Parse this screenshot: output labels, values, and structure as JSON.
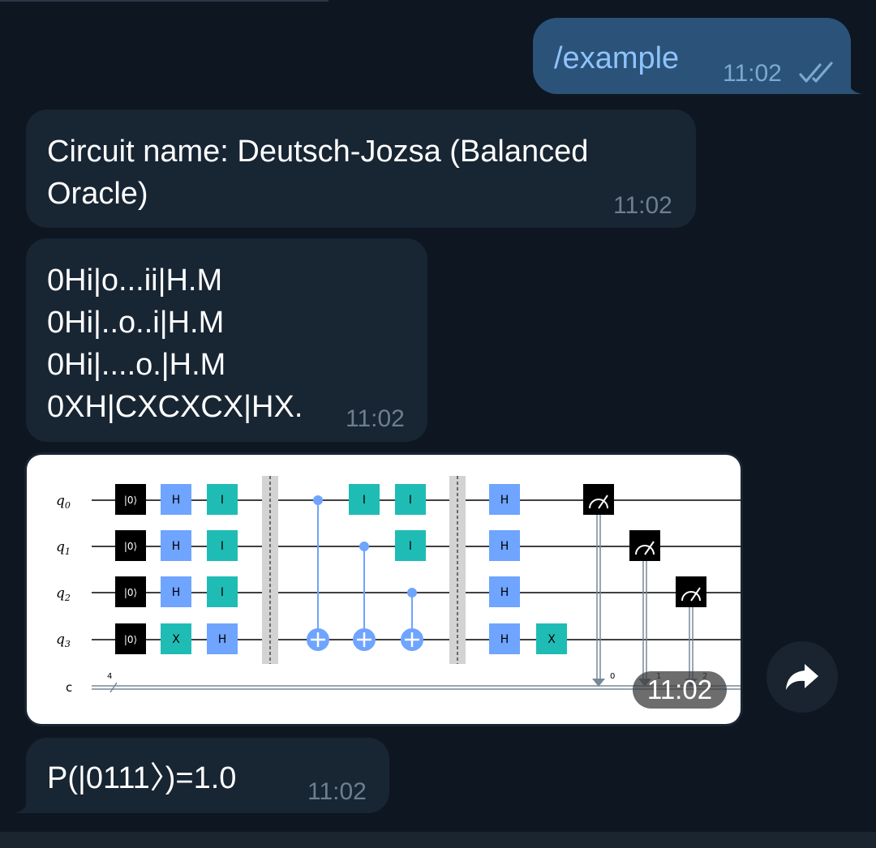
{
  "messages": [
    {
      "text": "/example",
      "time": "11:02",
      "status": "read"
    },
    {
      "line1": "Circuit name: Deutsch-Jozsa (Balanced",
      "line2": "Oracle)",
      "time": "11:02"
    },
    {
      "lines": [
        "0Hi|o...ii|H.M",
        "0Hi|..o..i|H.M",
        "0Hi|....o.|H.M",
        "0XH|CXCXCX|HX."
      ],
      "time": "11:02"
    },
    {
      "time": "11:02"
    },
    {
      "text": "P(|0111〉)=1.0",
      "time": "11:02"
    }
  ],
  "circuit": {
    "qubits": [
      "q",
      "q",
      "q",
      "q"
    ],
    "qubit_indices": [
      "0",
      "1",
      "2",
      "3"
    ],
    "classical": "c",
    "classical_width": "4",
    "init": "|0⟩",
    "gates": {
      "h": "H",
      "i": "I",
      "x": "X"
    },
    "measure_indices": [
      "0",
      "1",
      "2"
    ],
    "colors": {
      "h": "#6fa4ff",
      "i": "#1fbcb5",
      "x": "#1fbcb5",
      "cx": "#6fa4ff",
      "wire": "#000000",
      "classical": "#778899",
      "barrier": "#d3d3d3"
    }
  },
  "colors": {
    "outgoing": "#2b5278",
    "incoming": "#182533",
    "background": "#0e1621"
  },
  "icons": {
    "read": "double-check-icon",
    "share": "share-icon"
  }
}
